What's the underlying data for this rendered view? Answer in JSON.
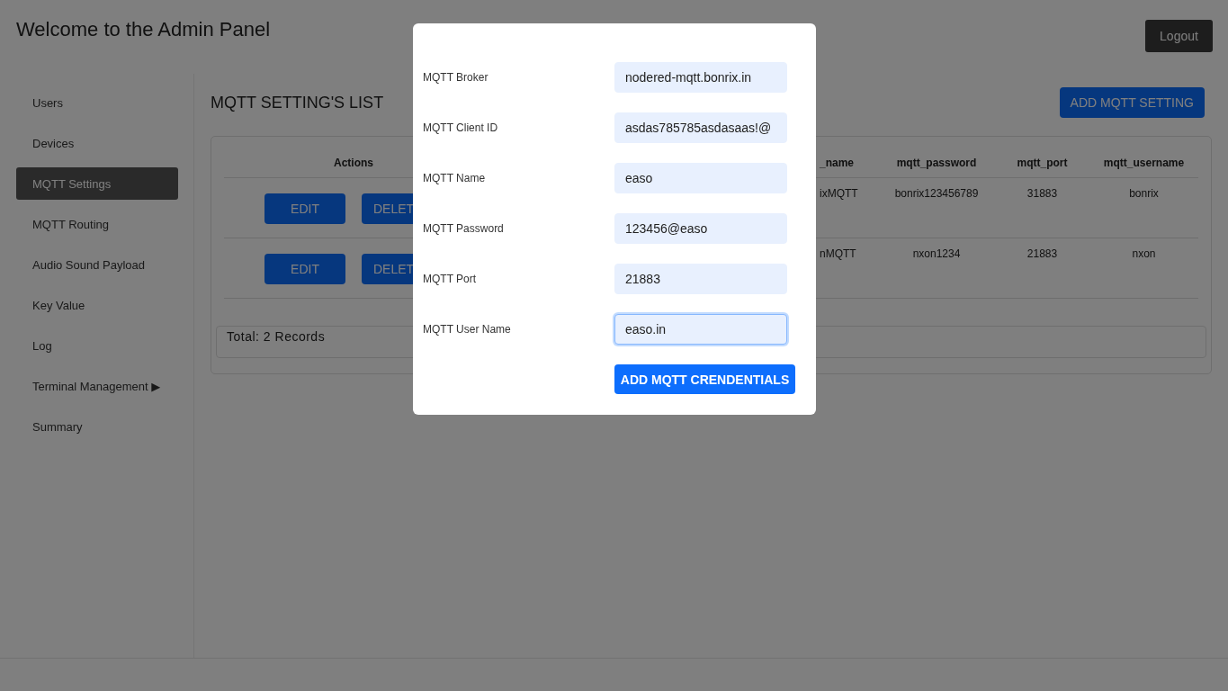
{
  "header": {
    "title": "Welcome to the Admin Panel",
    "logout": "Logout"
  },
  "sidebar": {
    "items": [
      {
        "label": "Users",
        "selected": false
      },
      {
        "label": "Devices",
        "selected": false
      },
      {
        "label": "MQTT Settings",
        "selected": true
      },
      {
        "label": "MQTT Routing",
        "selected": false
      },
      {
        "label": "Audio Sound Payload",
        "selected": false
      },
      {
        "label": "Key Value",
        "selected": false
      },
      {
        "label": "Log",
        "selected": false
      },
      {
        "label": "Terminal Management ▶",
        "selected": false
      },
      {
        "label": "Summary",
        "selected": false
      }
    ]
  },
  "main": {
    "title": "MQTT SETTING'S LIST",
    "add_button": "ADD MQTT SETTING",
    "table": {
      "columns": [
        "Actions",
        "_name",
        "mqtt_password",
        "mqtt_port",
        "mqtt_username"
      ],
      "rows": [
        {
          "cells": [
            {
              "edit": "EDIT",
              "delete": "DELET"
            },
            "ixMQTT",
            "bonrix123456789",
            "31883",
            "bonrix"
          ]
        },
        {
          "cells": [
            {
              "edit": "EDIT",
              "delete": "DELET"
            },
            "nMQTT",
            "nxon1234",
            "21883",
            "nxon"
          ]
        }
      ]
    },
    "total": "Total: 2 Records"
  },
  "modal": {
    "fields": [
      {
        "label": "MQTT Broker",
        "value": "nodered-mqtt.bonrix.in",
        "focused": false
      },
      {
        "label": "MQTT Client ID",
        "value": "asdas785785asdasaas!@",
        "focused": false
      },
      {
        "label": "MQTT Name",
        "value": "easo",
        "focused": false
      },
      {
        "label": "MQTT Password",
        "value": "123456@easo",
        "focused": false
      },
      {
        "label": "MQTT Port",
        "value": "21883",
        "focused": false
      },
      {
        "label": "MQTT User Name",
        "value": "easo.in",
        "focused": true
      }
    ],
    "submit": "ADD MQTT CRENDENTIALS"
  }
}
